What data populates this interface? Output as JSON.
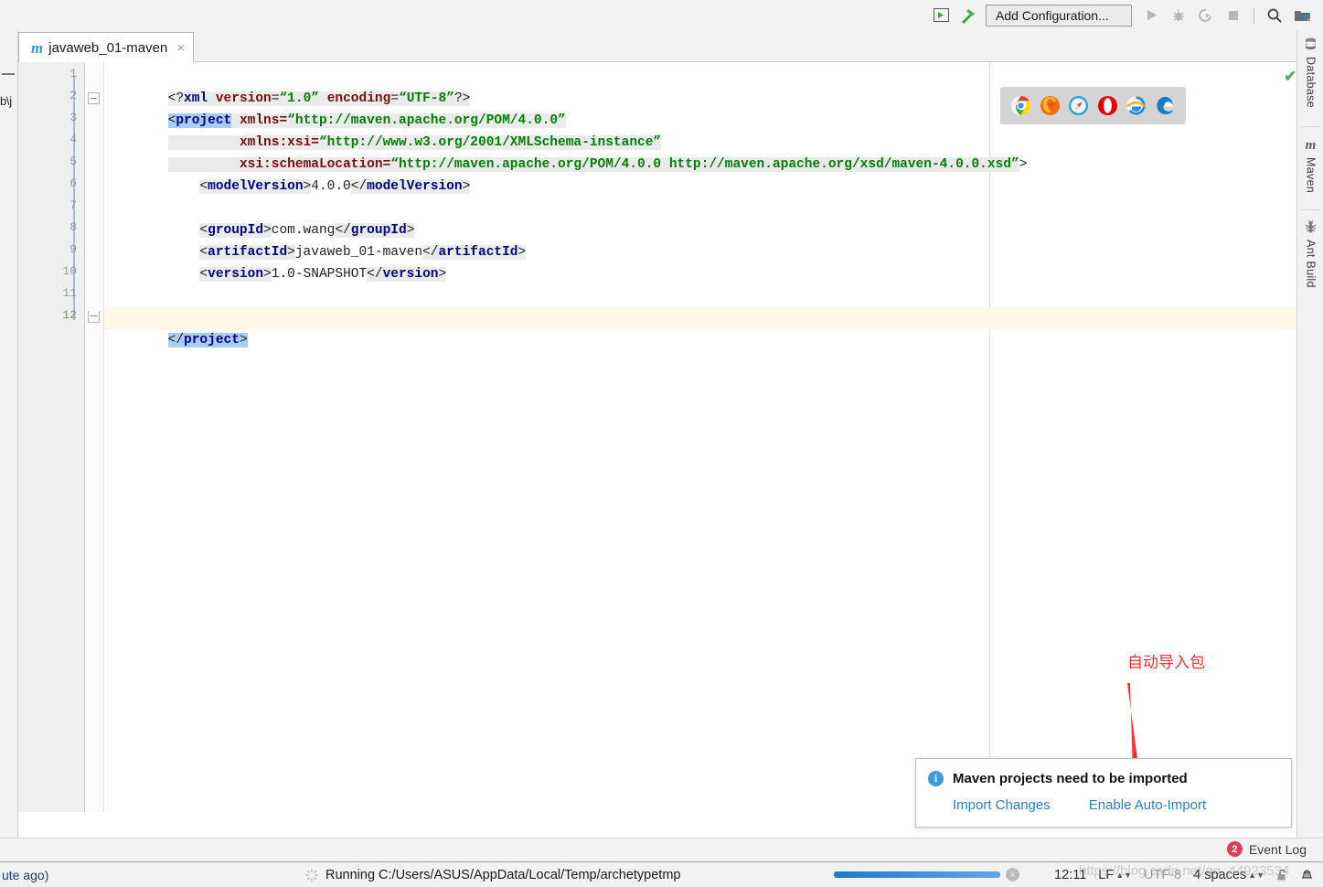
{
  "toolbar": {
    "icons": [
      {
        "name": "run-anything-icon",
        "glyph": "▶"
      },
      {
        "name": "build-hammer-icon",
        "glyph": "⚒"
      }
    ],
    "add_configuration_label": "Add Configuration...",
    "run_label": "▶",
    "debug_label": "🐞",
    "run_coverage_label": "Ⓒ",
    "stop_label": "■",
    "search_label": "🔍",
    "project_structure_label": "▤"
  },
  "left_edge": {
    "collapse_label": "—",
    "breadcrumb_partial": "b\\j"
  },
  "tab": {
    "icon_letter": "m",
    "label": "javaweb_01-maven",
    "close_label": "×"
  },
  "editor": {
    "line_numbers": [
      "1",
      "2",
      "3",
      "4",
      "5",
      "6",
      "7",
      "8",
      "9",
      "10",
      "11",
      "12"
    ],
    "current_line": 12,
    "inspection_status": "✔",
    "lines": [
      {
        "n": 1,
        "indent": 0,
        "text": "<?xml version=\"1.0\" encoding=\"UTF-8\"?>"
      },
      {
        "n": 2,
        "indent": 0,
        "text": "<project xmlns=\"http://maven.apache.org/POM/4.0.0\""
      },
      {
        "n": 3,
        "indent": 9,
        "text": "xmlns:xsi=\"http://www.w3.org/2001/XMLSchema-instance\""
      },
      {
        "n": 4,
        "indent": 9,
        "text": "xsi:schemaLocation=\"http://maven.apache.org/POM/4.0.0 http://maven.apache.org/xsd/maven-4.0.0.xsd\">"
      },
      {
        "n": 5,
        "indent": 4,
        "text": "<modelVersion>4.0.0</modelVersion>"
      },
      {
        "n": 6,
        "indent": 0,
        "text": ""
      },
      {
        "n": 7,
        "indent": 4,
        "text": "<groupId>com.wang</groupId>"
      },
      {
        "n": 8,
        "indent": 4,
        "text": "<artifactId>javaweb_01-maven</artifactId>"
      },
      {
        "n": 9,
        "indent": 4,
        "text": "<version>1.0-SNAPSHOT</version>"
      },
      {
        "n": 10,
        "indent": 0,
        "text": ""
      },
      {
        "n": 11,
        "indent": 0,
        "text": ""
      },
      {
        "n": 12,
        "indent": 0,
        "text": "</project>"
      }
    ],
    "tokens": {
      "xml_decl_open": "<?",
      "xml_decl_name": "xml",
      "attr_version": "version",
      "val_version": "\"1.0\"",
      "attr_encoding": "encoding",
      "val_encoding": "\"UTF-8\"",
      "xml_decl_close": "?>",
      "tag_project_open": "<project",
      "attr_xmlns": "xmlns=",
      "val_xmlns": "\"http://maven.apache.org/POM/4.0.0\"",
      "attr_xmlns_xsi": "xmlns:xsi=",
      "val_xmlns_xsi": "\"http://www.w3.org/2001/XMLSchema-instance\"",
      "attr_schemaloc": "xsi:schemaLocation=",
      "val_schemaloc": "\"http://maven.apache.org/POM/4.0.0 http://maven.apache.org/xsd/maven-4.0.0.xsd\"",
      "tag_close_gt": ">",
      "tag_modelversion_open": "<modelVersion>",
      "text_modelversion": "4.0.0",
      "tag_modelversion_close": "</modelVersion>",
      "tag_groupid_open": "<groupId>",
      "text_groupid": "com.wang",
      "tag_groupid_close": "</groupId>",
      "tag_artifactid_open": "<artifactId>",
      "text_artifactid": "javaweb_01-maven",
      "tag_artifactid_close": "</artifactId>",
      "tag_version_open": "<version>",
      "text_version": "1.0-SNAPSHOT",
      "tag_version_close": "</version>",
      "tag_project_close": "</project>"
    }
  },
  "browser_popup": {
    "browsers": [
      {
        "name": "chrome-icon",
        "color": "#2fa84f"
      },
      {
        "name": "firefox-icon",
        "color": "#e66000"
      },
      {
        "name": "safari-icon",
        "color": "#1f9ae0"
      },
      {
        "name": "opera-icon",
        "color": "#e60000"
      },
      {
        "name": "internet-explorer-icon",
        "color": "#56b0e8"
      },
      {
        "name": "edge-icon",
        "color": "#2a7cc7"
      }
    ]
  },
  "right_sidebar": {
    "items": [
      {
        "name": "database",
        "label": "Database",
        "icon": "⛃"
      },
      {
        "name": "maven",
        "label": "Maven",
        "icon": "m"
      },
      {
        "name": "ant-build",
        "label": "Ant Build",
        "icon": "☣"
      }
    ]
  },
  "annotation": {
    "text": "自动导入包",
    "color": "#f0332e"
  },
  "notification": {
    "info_glyph": "i",
    "title": "Maven projects need to be imported",
    "links": [
      {
        "name": "import-changes",
        "label": "Import Changes"
      },
      {
        "name": "enable-auto-import",
        "label": "Enable Auto-Import"
      }
    ]
  },
  "event_log": {
    "count": "2",
    "label": "Event Log"
  },
  "status_bar": {
    "left_text": "ute ago)",
    "task_text": "Running C:/Users/ASUS/AppData/Local/Temp/archetypetmp",
    "cancel_glyph": "×",
    "time": "12:11",
    "line_separator": "LF",
    "encoding": "UTF-8",
    "indent": "4 spaces",
    "lock_icon": "🔓",
    "extra_icon": "⚗",
    "watermark": "https://blog.csdn.net/qq_44923534"
  }
}
